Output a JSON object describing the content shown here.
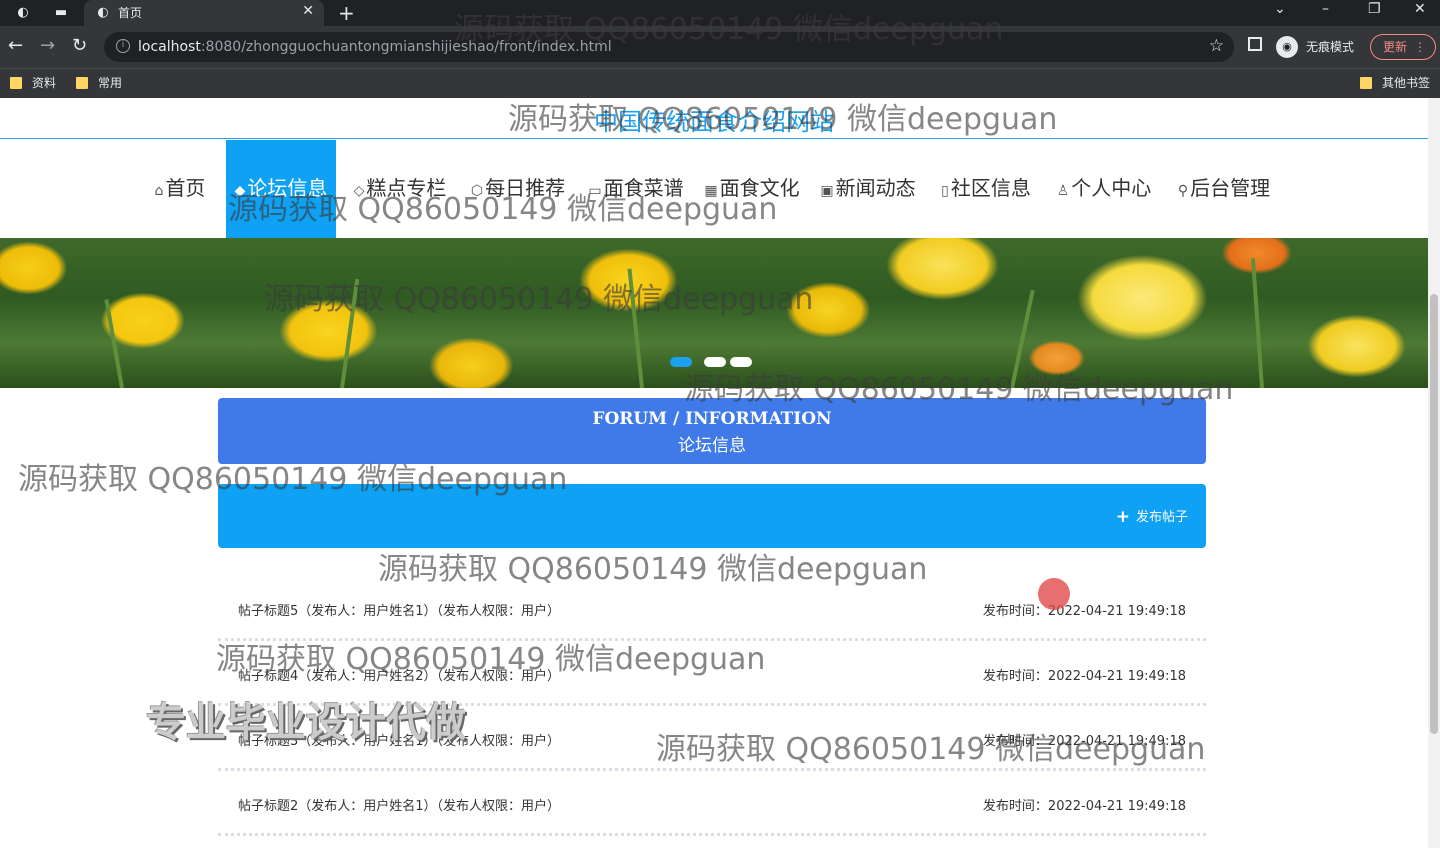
{
  "browser": {
    "tab_title": "首页",
    "url_host": "localhost",
    "url_rest": ":8080/zhongguochuantongmianshijieshao/front/index.html",
    "incognito_label": "无痕模式",
    "update_label": "更新",
    "bookmarks": [
      "资料",
      "常用"
    ],
    "other_bookmarks": "其他书签"
  },
  "site": {
    "title": "中国传统面食介绍网站",
    "menu": [
      {
        "label": "首页",
        "icon": "home-icon",
        "glyph": "⌂"
      },
      {
        "label": "论坛信息",
        "icon": "forum-icon",
        "glyph": "◆"
      },
      {
        "label": "糕点专栏",
        "icon": "tag-icon",
        "glyph": "◇"
      },
      {
        "label": "每日推荐",
        "icon": "cube-icon",
        "glyph": "⬡"
      },
      {
        "label": "面食菜谱",
        "icon": "menu-icon",
        "glyph": "▭"
      },
      {
        "label": "面食文化",
        "icon": "calendar-icon",
        "glyph": "▦"
      },
      {
        "label": "新闻动态",
        "icon": "news-icon",
        "glyph": "▣"
      },
      {
        "label": "社区信息",
        "icon": "community-icon",
        "glyph": "▯"
      },
      {
        "label": "个人中心",
        "icon": "user-icon",
        "glyph": "♙"
      },
      {
        "label": "后台管理",
        "icon": "link-icon",
        "glyph": "⚲"
      }
    ],
    "active_menu": "论坛信息"
  },
  "section": {
    "title_en": "FORUM / INFORMATION",
    "title_cn": "论坛信息",
    "post_button": "发布帖子"
  },
  "posts": [
    {
      "title": "帖子标题5（发布人：用户姓名1）（发布人权限：用户）",
      "time": "发布时间：2022-04-21 19:49:18"
    },
    {
      "title": "帖子标题4（发布人：用户姓名2）（发布人权限：用户）",
      "time": "发布时间：2022-04-21 19:49:18"
    },
    {
      "title": "帖子标题3（发布人：用户姓名1）（发布人权限：用户）",
      "time": "发布时间：2022-04-21 19:49:18"
    },
    {
      "title": "帖子标题2（发布人：用户姓名1）（发布人权限：用户）",
      "time": "发布时间：2022-04-21 19:49:18"
    }
  ],
  "watermark": "源码获取 QQ86050149 微信deepguan",
  "watermark_big": "专业毕业设计代做",
  "colors": {
    "accent": "#0ea1f4",
    "section_head": "#3f7ae8",
    "title": "#1ea0f0"
  }
}
